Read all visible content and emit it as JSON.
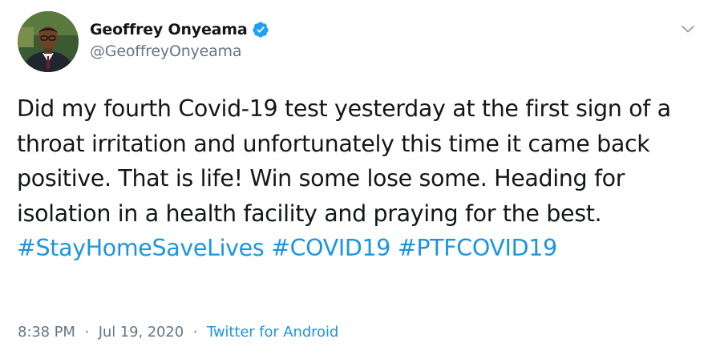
{
  "author": {
    "display_name": "Geoffrey Onyeama",
    "handle": "@GeoffreyOnyeama",
    "verified": true
  },
  "tweet": {
    "text_plain": "Did my fourth Covid-19 test yesterday at the first sign of a throat irritation and unfortunately this time it came back positive. That is life! Win some lose some. Heading for isolation in a health facility and praying for the best.",
    "hashtags": [
      "#StayHomeSaveLives",
      "#COVID19",
      "#PTFCOVID19"
    ]
  },
  "meta": {
    "time": "8:38 PM",
    "separator": "·",
    "date": "Jul 19, 2020",
    "source": "Twitter for Android"
  },
  "colors": {
    "link": "#1b95e0",
    "secondary_text": "#657786",
    "primary_text": "#14171a",
    "verified_badge": "#1da1f2"
  },
  "icons": {
    "verified": "verified-badge-icon",
    "menu": "chevron-down-icon"
  }
}
